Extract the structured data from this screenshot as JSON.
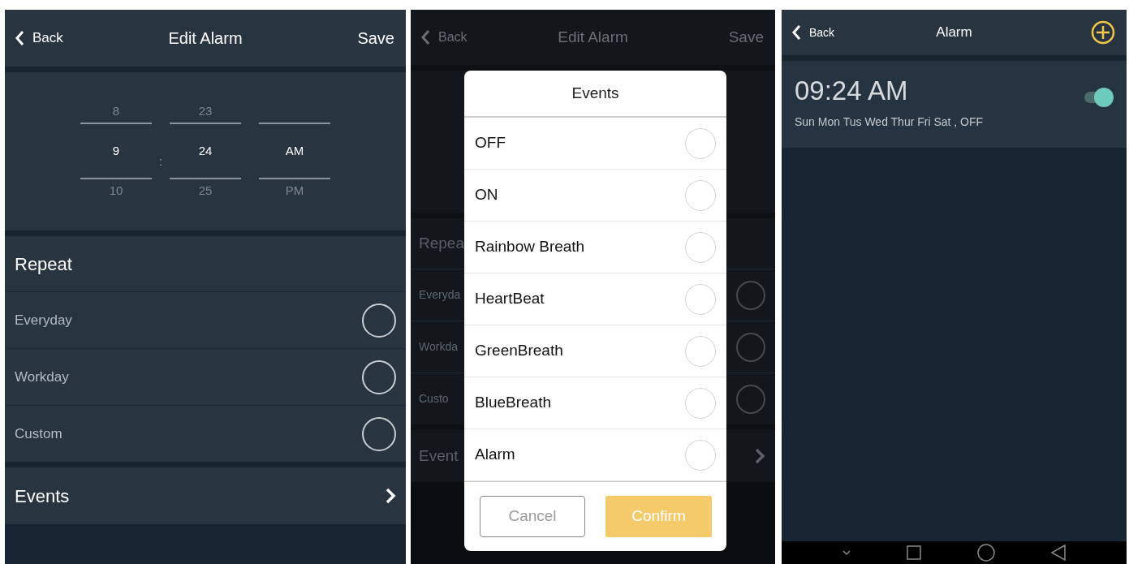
{
  "screens": [
    {
      "kind": "edit",
      "header": {
        "back": "Back",
        "title": "Edit Alarm",
        "action": "Save"
      },
      "picker": {
        "separator": ":",
        "columns": [
          {
            "above": "8",
            "value": "9",
            "below": "10"
          },
          {
            "above": "23",
            "value": "24",
            "below": "25"
          },
          {
            "value": "AM",
            "below": "PM"
          }
        ]
      },
      "repeat": {
        "title": "Repeat",
        "options": [
          {
            "label": "Everyday",
            "checked": false
          },
          {
            "label": "Workday",
            "checked": false
          },
          {
            "label": "Custom",
            "checked": false
          }
        ]
      },
      "events": {
        "label": "Events"
      }
    },
    {
      "kind": "dialog",
      "header": {
        "back": "Back",
        "title": "Edit Alarm",
        "action": "Save"
      },
      "repeat": {
        "title": "Repea",
        "options": [
          {
            "label": "Everyda",
            "checked": false
          },
          {
            "label": "Workda",
            "checked": false
          },
          {
            "label": "Custo",
            "checked": false
          }
        ]
      },
      "events": {
        "label": "Event"
      },
      "dialog": {
        "title": "Events",
        "options": [
          {
            "label": "OFF",
            "selected": false
          },
          {
            "label": "ON",
            "selected": false
          },
          {
            "label": "Rainbow Breath",
            "selected": false
          },
          {
            "label": "HeartBeat",
            "selected": false
          },
          {
            "label": "GreenBreath",
            "selected": false
          },
          {
            "label": "BlueBreath",
            "selected": false
          },
          {
            "label": "Alarm",
            "selected": false
          }
        ],
        "cancel": "Cancel",
        "confirm": "Confirm"
      }
    },
    {
      "kind": "list",
      "header": {
        "back": "Back",
        "title": "Alarm"
      },
      "alarms": [
        {
          "time": "09:24 AM",
          "detail": "Sun Mon Tus Wed Thur Fri Sat , OFF",
          "on": true
        }
      ]
    }
  ]
}
